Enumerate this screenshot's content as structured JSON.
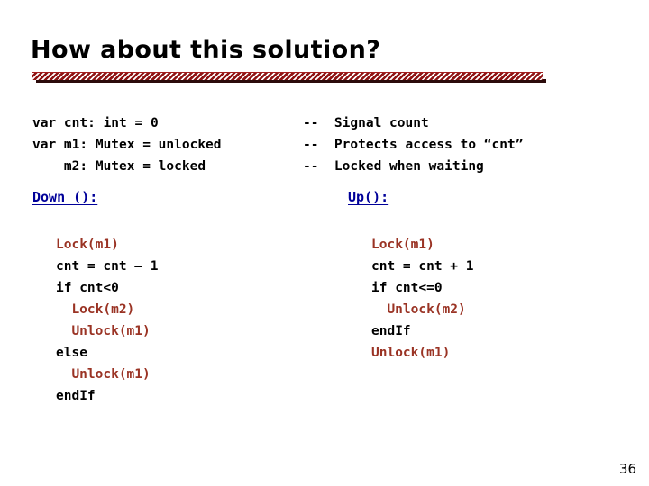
{
  "slide": {
    "title": "How about this solution?",
    "page_number": "36",
    "accent_color": "#8f1414",
    "link_color": "#000099",
    "call_color": "#9a3324"
  },
  "declarations": {
    "left": "var cnt: int = 0\nvar m1: Mutex = unlocked\n    m2: Mutex = locked",
    "right": "--  Signal count\n--  Protects access to “cnt”\n--  Locked when waiting"
  },
  "procedures": [
    {
      "heading": "Down ():",
      "lines": [
        {
          "text": "Lock(m1)",
          "kind": "call",
          "indent": 0
        },
        {
          "text": "cnt = cnt – 1",
          "kind": "kw",
          "indent": 0
        },
        {
          "text": "if cnt<0",
          "kind": "kw",
          "indent": 0
        },
        {
          "text": "Lock(m2)",
          "kind": "call",
          "indent": 1
        },
        {
          "text": "Unlock(m1)",
          "kind": "call",
          "indent": 1
        },
        {
          "text": "else",
          "kind": "kw",
          "indent": 0
        },
        {
          "text": "Unlock(m1)",
          "kind": "call",
          "indent": 1
        },
        {
          "text": "endIf",
          "kind": "kw",
          "indent": 0
        }
      ]
    },
    {
      "heading": "Up():",
      "lines": [
        {
          "text": "Lock(m1)",
          "kind": "call",
          "indent": 0
        },
        {
          "text": "cnt = cnt + 1",
          "kind": "kw",
          "indent": 0
        },
        {
          "text": "if cnt<=0",
          "kind": "kw",
          "indent": 0
        },
        {
          "text": "Unlock(m2)",
          "kind": "call",
          "indent": 1
        },
        {
          "text": "endIf",
          "kind": "kw",
          "indent": 0
        },
        {
          "text": "Unlock(m1)",
          "kind": "call",
          "indent": 0
        }
      ]
    }
  ]
}
